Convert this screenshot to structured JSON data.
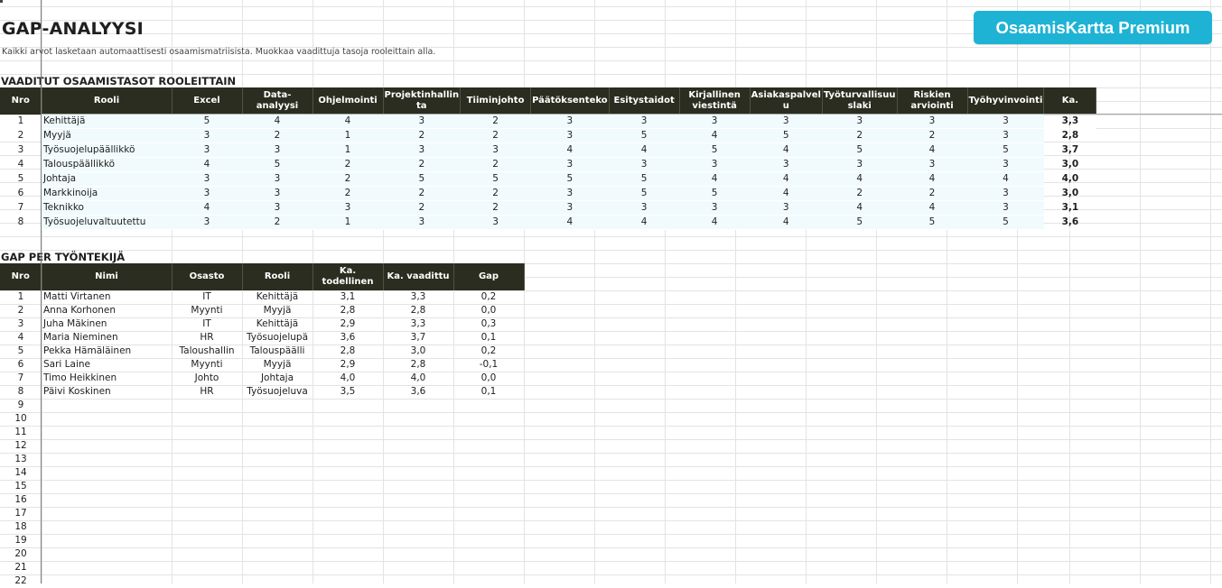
{
  "title": "GAP-ANALYYSI",
  "subtitle": "Kaikki arvot lasketaan automaattisesti osaamismatriisista. Muokkaa vaadittuja tasoja rooleittain alla.",
  "premium_button": "OsaamisKartta Premium",
  "colors": {
    "header_bg": "#2a2d1f",
    "accent": "#1eb3d4",
    "row_tint": "#f1fbfd"
  },
  "roles_section": {
    "title": "VAADITUT OSAAMISTASOT ROOLEITTAIN",
    "headers": [
      "Nro",
      "Rooli",
      "Excel",
      "Data-analyysi",
      "Ohjelmointi",
      "Projektinhallin ta",
      "Tiiminjohto",
      "Päätöksenteko",
      "Esitystaidot",
      "Kirjallinen viestintä",
      "Asiakaspalvel u",
      "Työturvallisuu slaki",
      "Riskien arviointi",
      "Työhyvinvointi",
      "Ka."
    ],
    "rows": [
      [
        "1",
        "Kehittäjä",
        "5",
        "4",
        "4",
        "3",
        "2",
        "3",
        "3",
        "3",
        "3",
        "3",
        "3",
        "3",
        "3,3"
      ],
      [
        "2",
        "Myyjä",
        "3",
        "2",
        "1",
        "2",
        "2",
        "3",
        "5",
        "4",
        "5",
        "2",
        "2",
        "3",
        "2,8"
      ],
      [
        "3",
        "Työsuojelupäällikkö",
        "3",
        "3",
        "1",
        "3",
        "3",
        "4",
        "4",
        "5",
        "4",
        "5",
        "4",
        "5",
        "3,7"
      ],
      [
        "4",
        "Talouspäällikkö",
        "4",
        "5",
        "2",
        "2",
        "2",
        "3",
        "3",
        "3",
        "3",
        "3",
        "3",
        "3",
        "3,0"
      ],
      [
        "5",
        "Johtaja",
        "3",
        "3",
        "2",
        "5",
        "5",
        "5",
        "5",
        "4",
        "4",
        "4",
        "4",
        "4",
        "4,0"
      ],
      [
        "6",
        "Markkinoija",
        "3",
        "3",
        "2",
        "2",
        "2",
        "3",
        "5",
        "5",
        "4",
        "2",
        "2",
        "3",
        "3,0"
      ],
      [
        "7",
        "Teknikko",
        "4",
        "3",
        "3",
        "2",
        "2",
        "3",
        "3",
        "3",
        "3",
        "4",
        "4",
        "3",
        "3,1"
      ],
      [
        "8",
        "Työsuojeluvaltuutettu",
        "3",
        "2",
        "1",
        "3",
        "3",
        "4",
        "4",
        "4",
        "4",
        "5",
        "5",
        "5",
        "3,6"
      ]
    ]
  },
  "gap_section": {
    "title": "GAP PER TYÖNTEKIJÄ",
    "headers": [
      "Nro",
      "Nimi",
      "Osasto",
      "Rooli",
      "Ka. todellinen",
      "Ka. vaadittu",
      "Gap"
    ],
    "rows": [
      [
        "1",
        "Matti Virtanen",
        "IT",
        "Kehittäjä",
        "3,1",
        "3,3",
        "0,2"
      ],
      [
        "2",
        "Anna Korhonen",
        "Myynti",
        "Myyjä",
        "2,8",
        "2,8",
        "0,0"
      ],
      [
        "3",
        "Juha Mäkinen",
        "IT",
        "Kehittäjä",
        "2,9",
        "3,3",
        "0,3"
      ],
      [
        "4",
        "Maria Nieminen",
        "HR",
        "Työsuojelupä",
        "3,6",
        "3,7",
        "0,1"
      ],
      [
        "5",
        "Pekka Hämäläinen",
        "Taloushallin",
        "Talouspäälli",
        "2,8",
        "3,0",
        "0,2"
      ],
      [
        "6",
        "Sari Laine",
        "Myynti",
        "Myyjä",
        "2,9",
        "2,8",
        "-0,1"
      ],
      [
        "7",
        "Timo Heikkinen",
        "Johto",
        "Johtaja",
        "4,0",
        "4,0",
        "0,0"
      ],
      [
        "8",
        "Päivi Koskinen",
        "HR",
        "Työsuojeluva",
        "3,5",
        "3,6",
        "0,1"
      ]
    ],
    "empty_rows": [
      "9",
      "10",
      "11",
      "12",
      "13",
      "14",
      "15",
      "16",
      "17",
      "18",
      "19",
      "20",
      "21",
      "22"
    ]
  }
}
